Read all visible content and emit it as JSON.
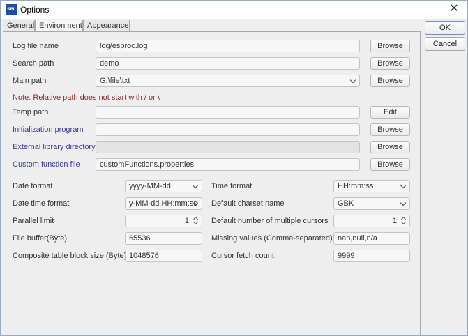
{
  "window": {
    "app_icon_text": "SPL",
    "title": "Options",
    "close_glyph": "✕"
  },
  "tabs": [
    {
      "label": "General",
      "active": false
    },
    {
      "label": "Environment",
      "active": true
    },
    {
      "label": "Appearance",
      "active": false
    }
  ],
  "side_buttons": {
    "ok_label": "OK",
    "ok_mnemonic": "O",
    "ok_rest": "K",
    "cancel_label": "Cancel",
    "cancel_mnemonic": "C",
    "cancel_rest": "ancel"
  },
  "paths": {
    "log_file": {
      "label": "Log file name",
      "value": "log/esproc.log",
      "button": "Browse"
    },
    "search_path": {
      "label": "Search path",
      "value": "demo",
      "button": "Browse"
    },
    "main_path": {
      "label": "Main path",
      "value": "G:\\file\\txt",
      "button": "Browse"
    },
    "note": "Note: Relative path does not start with / or \\",
    "temp_path": {
      "label": "Temp path",
      "value": "",
      "button": "Edit"
    },
    "init_program": {
      "label": "Initialization program",
      "value": "",
      "button": "Browse"
    },
    "ext_lib_dir": {
      "label": "External library directory",
      "value": "",
      "button": "Browse"
    },
    "custom_func_file": {
      "label": "Custom function file",
      "value": "customFunctions.properties",
      "button": "Browse"
    }
  },
  "settings": {
    "date_format": {
      "label": "Date format",
      "value": "yyyy-MM-dd"
    },
    "time_format": {
      "label": "Time format",
      "value": "HH:mm:ss"
    },
    "datetime_format": {
      "label": "Date time format",
      "value": "y-MM-dd HH:mm:ss"
    },
    "charset": {
      "label": "Default charset name",
      "value": "GBK"
    },
    "parallel_limit": {
      "label": "Parallel limit",
      "value": "1"
    },
    "multi_cursors": {
      "label": "Default number of multiple cursors",
      "value": "1"
    },
    "file_buffer": {
      "label": "File buffer(Byte)",
      "value": "65536"
    },
    "missing_values": {
      "label": "Missing values (Comma-separated)",
      "value": "nan,null,n/a"
    },
    "block_size": {
      "label": "Composite table block size (Byte)",
      "value": "1048576"
    },
    "cursor_fetch": {
      "label": "Cursor fetch count",
      "value": "9999"
    }
  },
  "colors": {
    "link_label": "#3a3aa0",
    "note_text": "#8b2b2b",
    "app_icon": "#1e4fa3"
  }
}
